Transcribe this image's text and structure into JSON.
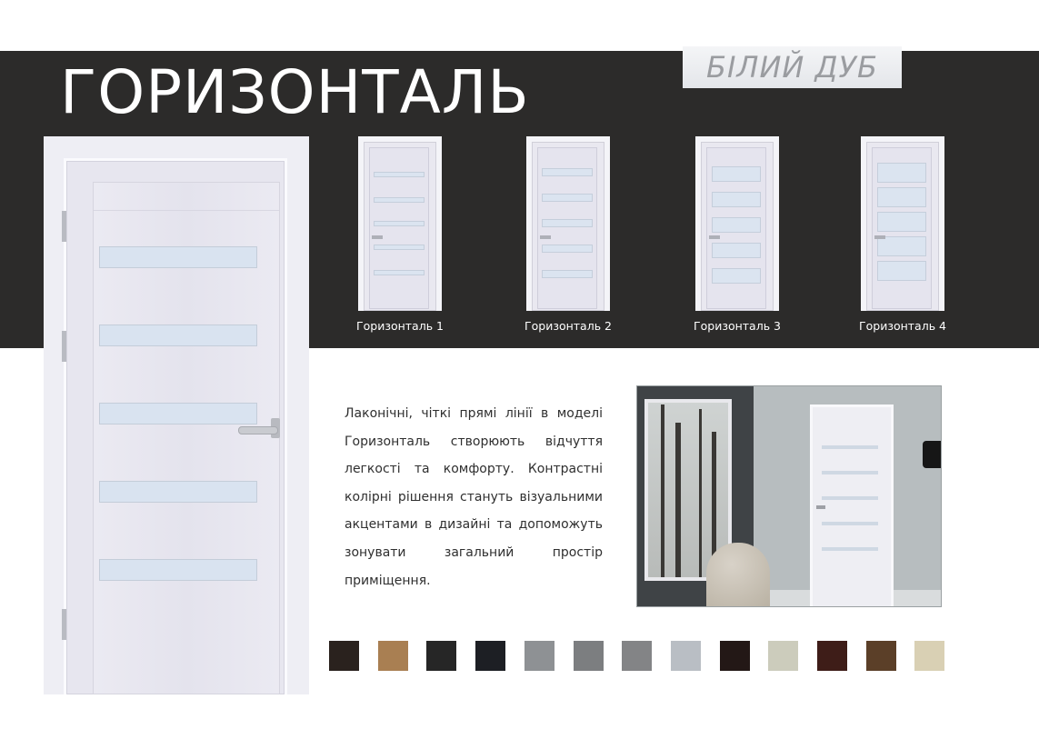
{
  "title": "ГОРИЗОНТАЛЬ",
  "finish_badge": "БІЛИЙ ДУБ",
  "models": [
    {
      "label": "Горизонталь 1"
    },
    {
      "label": "Горизонталь 2"
    },
    {
      "label": "Горизонталь 3"
    },
    {
      "label": "Горизонталь 4"
    }
  ],
  "description": "Лаконічні, чіткі прямі лінії в моделі Горизонталь створюють відчуття легкості та комфорту. Контрастні колірні рішення стануть візуальними акцентами в дизайні та допоможуть зонувати загальний простір приміщення.",
  "colors": {
    "band": "#2c2b2a",
    "swatches": [
      "#2a221e",
      "#a97f52",
      "#262626",
      "#1d1f24",
      "#8e9194",
      "#7c7e80",
      "#838486",
      "#b9bec4",
      "#231816",
      "#ccccbc",
      "#3e1d18",
      "#5b3f28",
      "#d9d0b4"
    ]
  }
}
